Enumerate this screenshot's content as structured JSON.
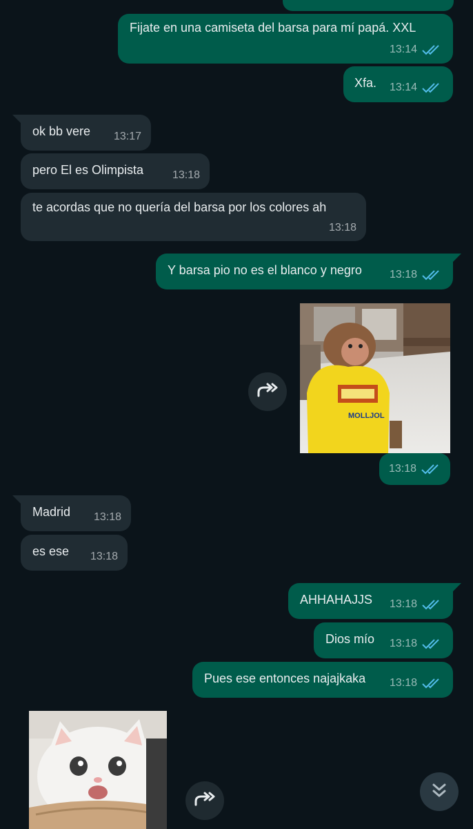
{
  "messages": {
    "m1": {
      "text": "Fijate en una camiseta del barsa para mí papá. XXL",
      "time": "13:14"
    },
    "m2": {
      "text": "Xfa.",
      "time": "13:14"
    },
    "m3": {
      "text": "ok bb vere",
      "time": "13:17"
    },
    "m4": {
      "text": "pero El es Olimpista",
      "time": "13:18"
    },
    "m5": {
      "text": "te acordas que no quería del barsa por los colores ah",
      "time": "13:18"
    },
    "m6": {
      "text": "Y barsa pio no es el blanco y negro",
      "time": "13:18"
    },
    "m7": {
      "time": "13:18"
    },
    "m8": {
      "text": "Madrid",
      "time": "13:18"
    },
    "m9": {
      "text": "es ese",
      "time": "13:18"
    },
    "m10": {
      "text": "AHHAHAJJS",
      "time": "13:18"
    },
    "m11": {
      "text": "Dios mío",
      "time": "13:18"
    },
    "m12": {
      "text": "Pues ese entonces najajkaka",
      "time": "13:18"
    }
  },
  "icons": {
    "read_receipt": "double-check-icon",
    "forward": "forward-icon",
    "scroll_down": "chevron-double-down-icon"
  },
  "colors": {
    "background": "#0b141a",
    "outgoing_bubble": "#005c4b",
    "incoming_bubble": "#202c33",
    "read_tick": "#53bdeb"
  }
}
